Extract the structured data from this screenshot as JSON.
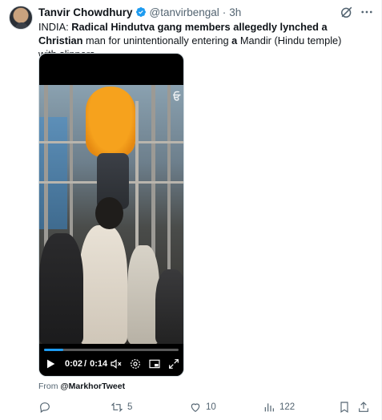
{
  "author": {
    "name": "Tanvir Chowdhury",
    "handle": "@tanvirbengal",
    "separator": "·",
    "time": "3h"
  },
  "tweet": {
    "text_segments": [
      {
        "text": "INDIA: ",
        "bold": false
      },
      {
        "text": "Radical Hindutva gang members allegedly lynched a Christian",
        "bold": true
      },
      {
        "text": " man for unintentionally entering ",
        "bold": false
      },
      {
        "text": "a",
        "bold": true
      },
      {
        "text": " Mandir (Hindu temple) with slippers.",
        "bold": false
      }
    ]
  },
  "video": {
    "watermark": "ਓ",
    "elapsed": "0:02",
    "divider": "/",
    "duration": "0:14",
    "progress_fraction": 0.14
  },
  "source": {
    "prefix": "From ",
    "account": "@MarkhorTweet"
  },
  "actions": {
    "replies": "",
    "retweets": "5",
    "likes": "10",
    "views": "122"
  },
  "colors": {
    "accent": "#1d9bf0",
    "muted": "#536471",
    "text": "#0f1419"
  },
  "icons": [
    "verified-badge-icon",
    "grok-icon",
    "more-icon",
    "play-icon",
    "mute-icon",
    "settings-icon",
    "pip-icon",
    "fullscreen-icon",
    "reply-icon",
    "retweet-icon",
    "like-icon",
    "views-icon",
    "bookmark-icon",
    "share-icon"
  ]
}
